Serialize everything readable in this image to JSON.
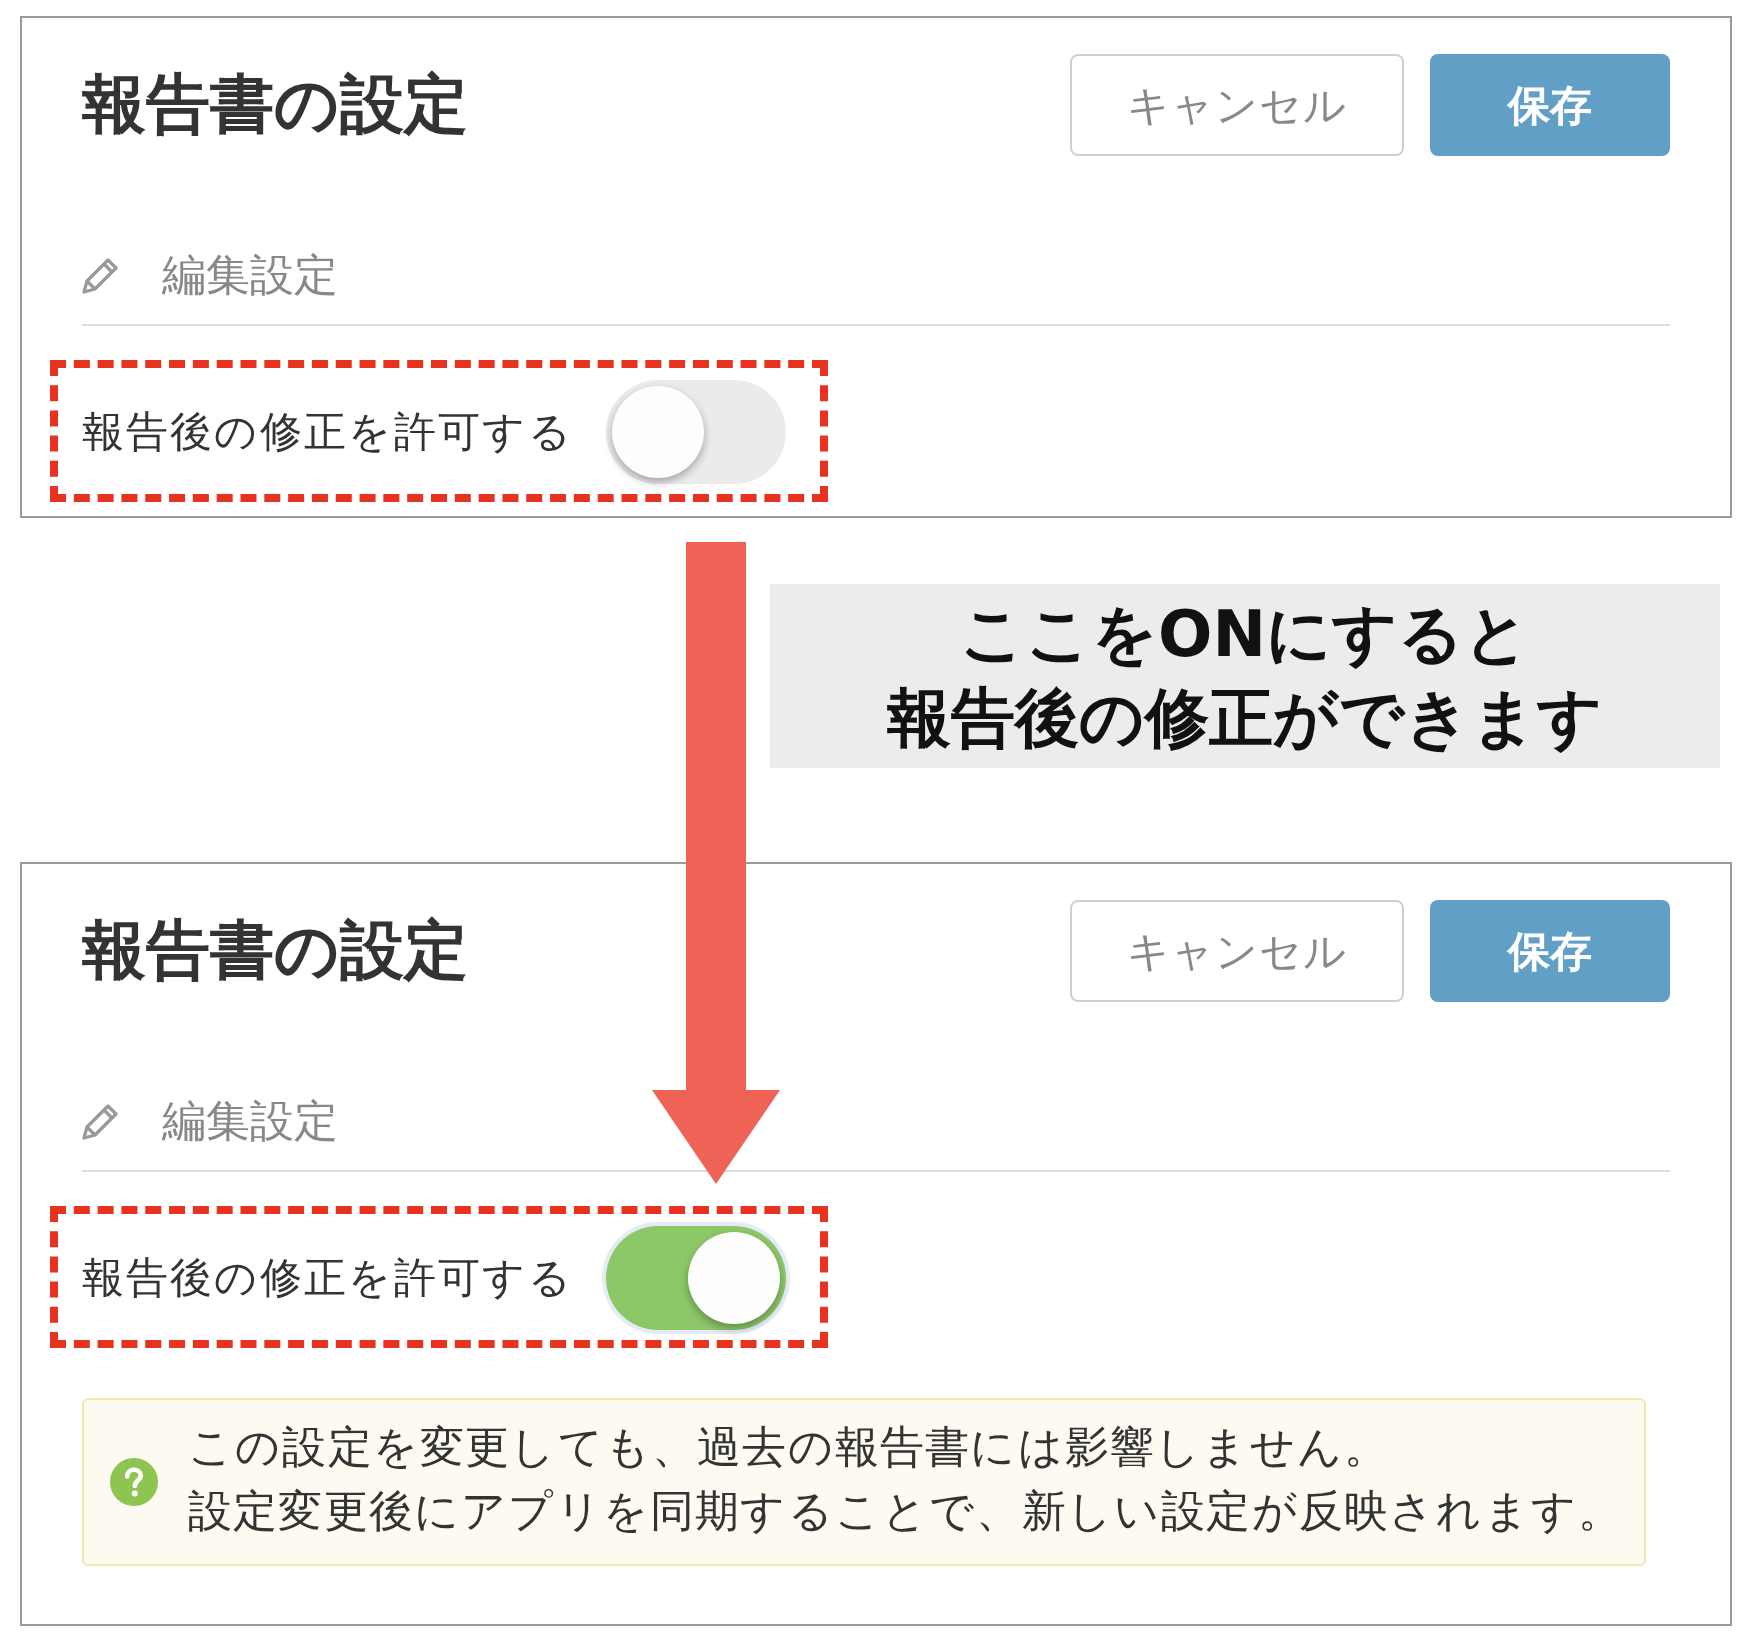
{
  "panels": [
    {
      "title": "報告書の設定",
      "buttons": [
        {
          "label": "キャンセル",
          "kind": "secondary"
        },
        {
          "label": "保存",
          "kind": "primary"
        }
      ],
      "section": "編集設定",
      "setting": {
        "label": "報告後の修正を許可する",
        "on": false,
        "highlighted": true
      }
    },
    {
      "title": "報告書の設定",
      "buttons": [
        {
          "label": "キャンセル",
          "kind": "secondary"
        },
        {
          "label": "保存",
          "kind": "primary"
        }
      ],
      "section": "編集設定",
      "setting": {
        "label": "報告後の修正を許可する",
        "on": true,
        "highlighted": true
      },
      "note": [
        "この設定を変更しても、過去の報告書には影響しません。",
        "設定変更後にアプリを同期することで、新しい設定が反映されます。"
      ]
    }
  ],
  "callout": {
    "lines": [
      "ここをONにすると",
      "報告後の修正ができます"
    ]
  }
}
